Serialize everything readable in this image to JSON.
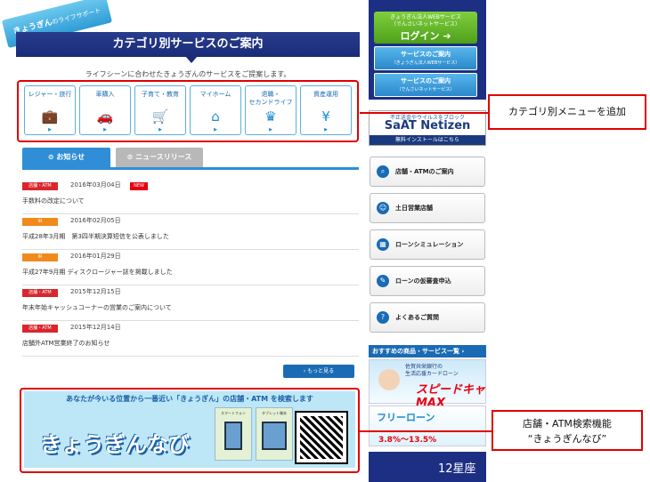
{
  "header": {
    "ribbon_main": "きょうぎん",
    "ribbon_sub": "のライフサポート",
    "banner_title": "カテゴリ別サービスのご案内",
    "intro": "ライフシーンに合わせたきょうぎんのサービスをご提案します。"
  },
  "categories": [
    {
      "label": "レジャー・旅行",
      "icon": "suitcase-icon"
    },
    {
      "label": "車購入",
      "icon": "car-icon"
    },
    {
      "label": "子育て・教育",
      "icon": "stroller-icon"
    },
    {
      "label": "マイホーム",
      "icon": "house-icon"
    },
    {
      "label": "退職・\nセカンドライフ",
      "icon": "trophy-icon"
    },
    {
      "label": "資産運用",
      "icon": "money-icon"
    }
  ],
  "tabs": {
    "notice": "お知らせ",
    "news_release": "ニュースリリース"
  },
  "news": [
    {
      "badge": "店舗・ATM",
      "badge_color": "#d9262e",
      "date": "2016年03月04日",
      "is_new": true,
      "new_label": "NEW",
      "title": "手数料の改定について"
    },
    {
      "badge": "IR",
      "badge_color": "#f08a1c",
      "date": "2016年02月05日",
      "is_new": false,
      "new_label": "",
      "title": "平成28年3月期　第3四半期決算短信を公表しました"
    },
    {
      "badge": "IR",
      "badge_color": "#f08a1c",
      "date": "2016年01月29日",
      "is_new": false,
      "new_label": "",
      "title": "平成27年9月期 ディスクロージャー誌を掲載しました"
    },
    {
      "badge": "店舗・ATM",
      "badge_color": "#d9262e",
      "date": "2015年12月15日",
      "is_new": false,
      "new_label": "",
      "title": "年末年始キャッシュコーナーの営業のご案内について"
    },
    {
      "badge": "店舗・ATM",
      "badge_color": "#d9262e",
      "date": "2015年12月14日",
      "is_new": false,
      "new_label": "",
      "title": "店舗外ATM営業終了のお知らせ"
    }
  ],
  "more_label": "もっと見る",
  "navi": {
    "headline": "あなたが今いる位置から一番近い「きょうぎん」の店舗・ATM を検索します",
    "logo": "きょうぎんなび",
    "smartphone": "スマートフォン",
    "tablet": "タブレット端末"
  },
  "sidebar": {
    "login_sub": "きょうぎん法人WEBサービス\n（でんさいネットサービス）",
    "login_label": "ログイン",
    "svc1": "サービスのご案内",
    "svc1_sub": "（きょうぎん法人WEBサービス）",
    "svc2": "サービスのご案内",
    "svc2_sub": "（でんさいネットサービス）",
    "saat_tag": "不正送金やウイルスをブロック",
    "saat_name": "SaAT Netizen",
    "saat_free": "無料インストールはこちら",
    "menu": [
      {
        "label": "店舗・ATMのご案内",
        "icon": "search-icon"
      },
      {
        "label": "土日営業店舗",
        "icon": "person-icon"
      },
      {
        "label": "ローンシミュレーション",
        "icon": "calculator-icon"
      },
      {
        "label": "ローンの仮審査申込",
        "icon": "document-icon"
      },
      {
        "label": "よくあるご質問",
        "icon": "question-icon"
      }
    ],
    "rec_header": "おすすめの商品・サービス一覧",
    "rec1_sub": "佐賀共栄銀行の\n生活応援カードローン",
    "rec1_title": "スピードキャMAX",
    "rec2_title": "フリーローン",
    "rec2_rate": "3.8%〜13.5%",
    "rec3_title": "12星座"
  },
  "callouts": {
    "category": "カテゴリ別メニューを追加",
    "navi": "店舗・ATM検索機能\n“きょうぎんなび”"
  }
}
